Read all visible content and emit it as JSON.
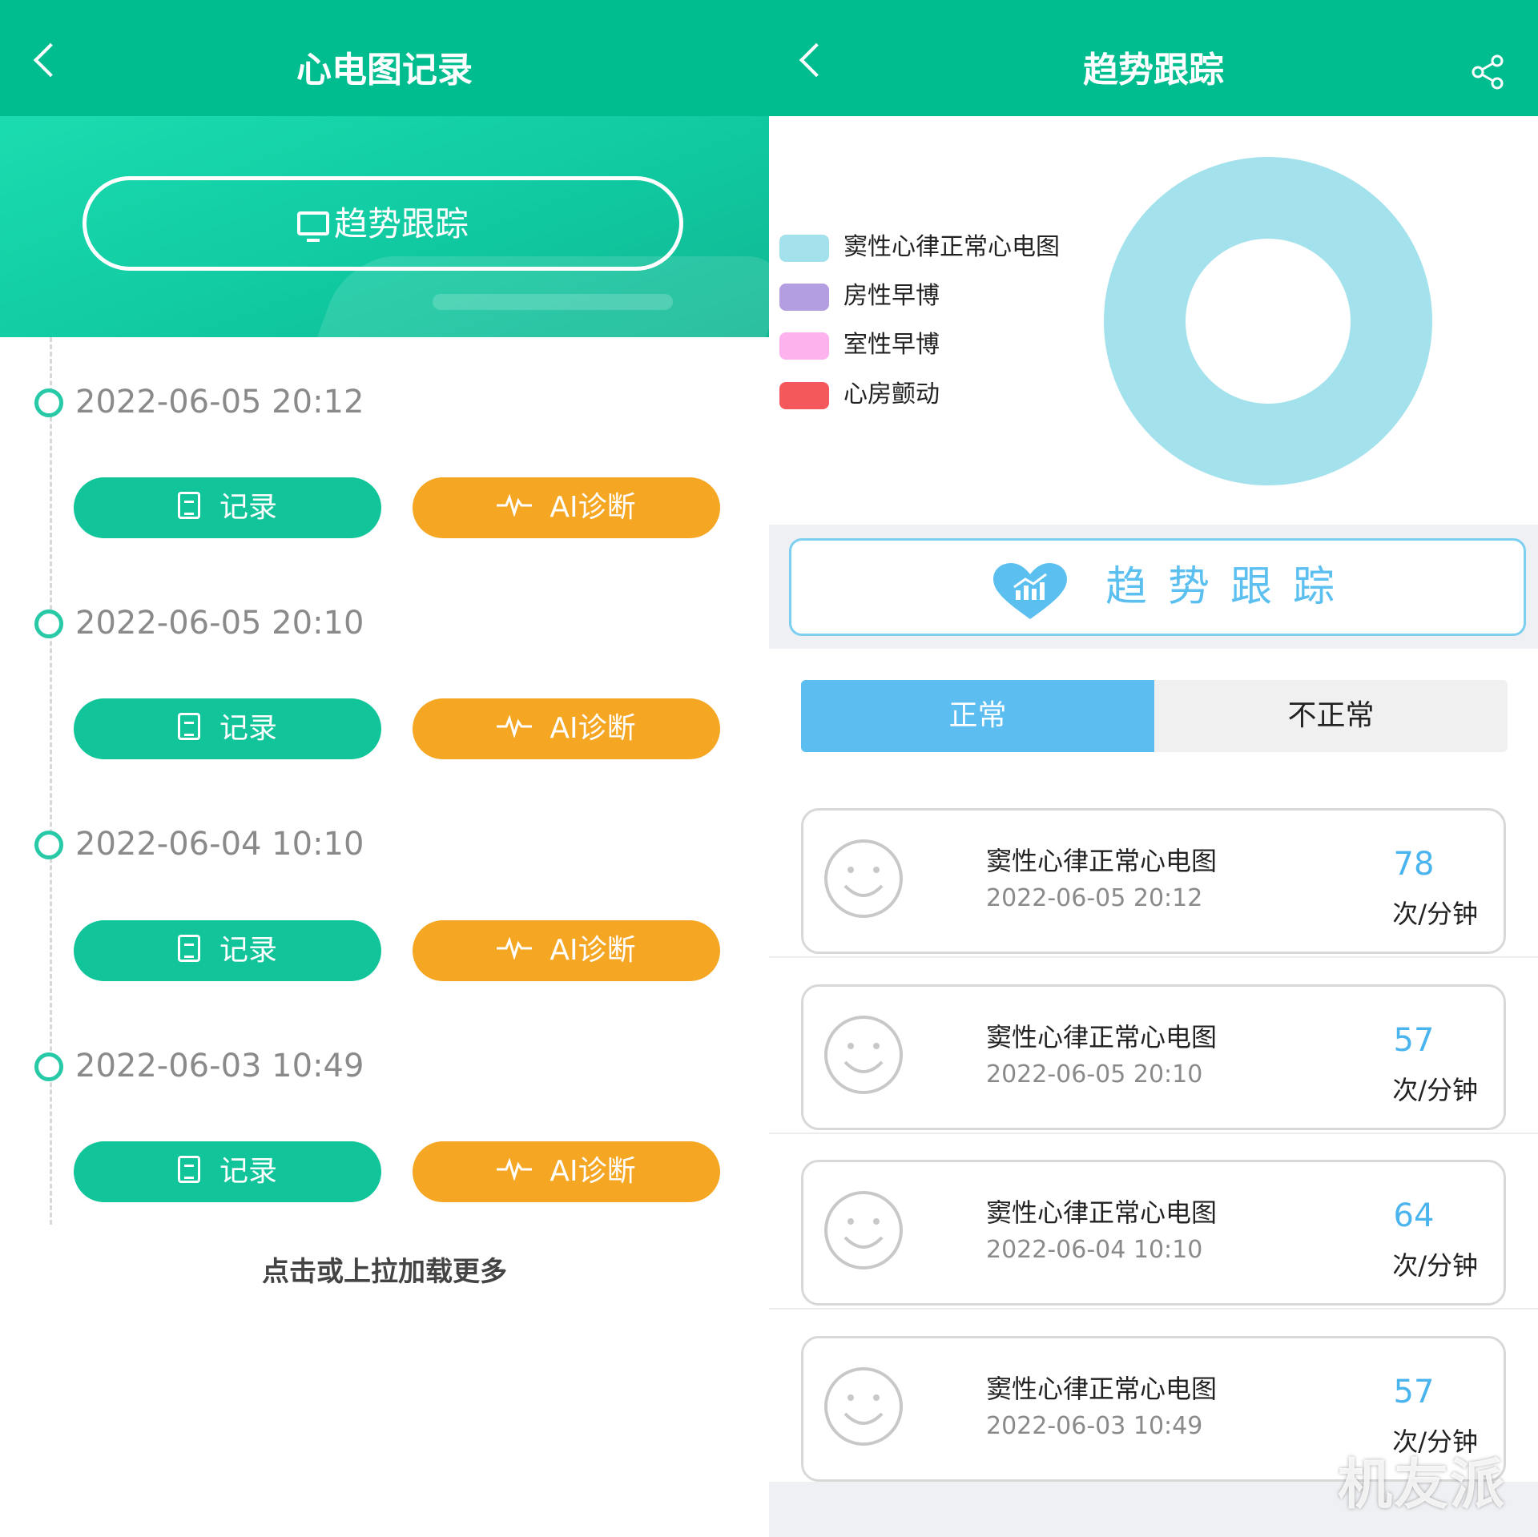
{
  "left": {
    "header": {
      "title": "心电图记录"
    },
    "trend_button": {
      "label": "趋势跟踪"
    },
    "entries": [
      {
        "date": "2022-06-05 20:12",
        "record_label": "记录",
        "ai_label": "AI诊断"
      },
      {
        "date": "2022-06-05 20:10",
        "record_label": "记录",
        "ai_label": "AI诊断"
      },
      {
        "date": "2022-06-04 10:10",
        "record_label": "记录",
        "ai_label": "AI诊断"
      },
      {
        "date": "2022-06-03 10:49",
        "record_label": "记录",
        "ai_label": "AI诊断"
      }
    ],
    "load_more": "点击或上拉加载更多"
  },
  "right": {
    "header": {
      "title": "趋势跟踪"
    },
    "chart_data": {
      "type": "pie",
      "donut": true,
      "legend": "left",
      "categories": [
        "窦性心律正常心电图",
        "房性早博",
        "室性早博",
        "心房颤动"
      ],
      "values": [
        4,
        0,
        0,
        0
      ],
      "colors": [
        "#a3e1ec",
        "#b49ee2",
        "#fdb2ee",
        "#f4585a"
      ]
    },
    "trend_card": {
      "label": "趋势跟踪"
    },
    "tabs": {
      "normal": "正常",
      "abnormal": "不正常",
      "active": "normal"
    },
    "records": [
      {
        "name": "窦性心律正常心电图",
        "time": "2022-06-05 20:12",
        "bpm": "78",
        "unit": "次/分钟"
      },
      {
        "name": "窦性心律正常心电图",
        "time": "2022-06-05 20:10",
        "bpm": "57",
        "unit": "次/分钟"
      },
      {
        "name": "窦性心律正常心电图",
        "time": "2022-06-04 10:10",
        "bpm": "64",
        "unit": "次/分钟"
      },
      {
        "name": "窦性心律正常心电图",
        "time": "2022-06-03 10:49",
        "bpm": "57",
        "unit": "次/分钟"
      }
    ],
    "watermark": "机友派"
  },
  "colors": {
    "header_green": "#00bd8f",
    "button_green": "#12c49a",
    "button_orange": "#f5a623",
    "tab_blue": "#5bbdf0",
    "bpm_blue": "#4ab4ee"
  },
  "icons": {
    "back": "chevron-left-icon",
    "share": "share-icon",
    "monitor": "monitor-chart-icon",
    "record": "notepad-icon",
    "ai": "heartbeat-icon",
    "heart": "heart-chart-icon",
    "face": "smiley-face-icon"
  }
}
